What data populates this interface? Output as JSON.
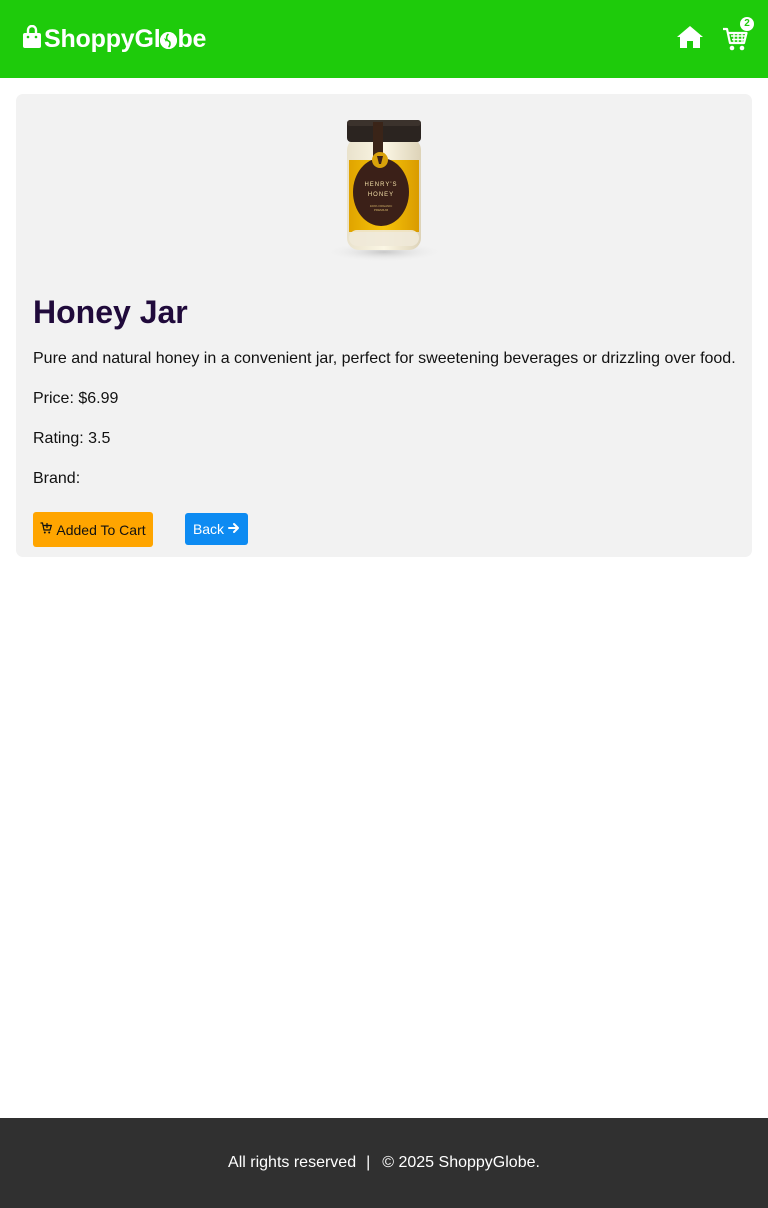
{
  "header": {
    "logo_text_before": "ShoppyGl",
    "logo_text_after": "be",
    "cart_count": "2",
    "icons": [
      "shopping-bag-icon",
      "home-icon",
      "cart-icon"
    ],
    "background_color": "#1ecb0b"
  },
  "product": {
    "title": "Honey Jar",
    "description": "Pure and natural honey in a convenient jar, perfect for sweetening beverages or drizzling over food.",
    "price_line": "Price: $6.99",
    "rating_line": "Rating: 3.5",
    "brand_line": "Brand:",
    "image_alt": "Honey jar product image"
  },
  "actions": {
    "add_to_cart_label": "Added To Cart",
    "back_label": "Back",
    "add_to_cart_color": "#ffa500",
    "back_color": "#0d8bf2"
  },
  "footer": {
    "rights_text": "All rights reserved",
    "separator": "|",
    "copyright_text": "© 2025 ShoppyGlobe."
  }
}
